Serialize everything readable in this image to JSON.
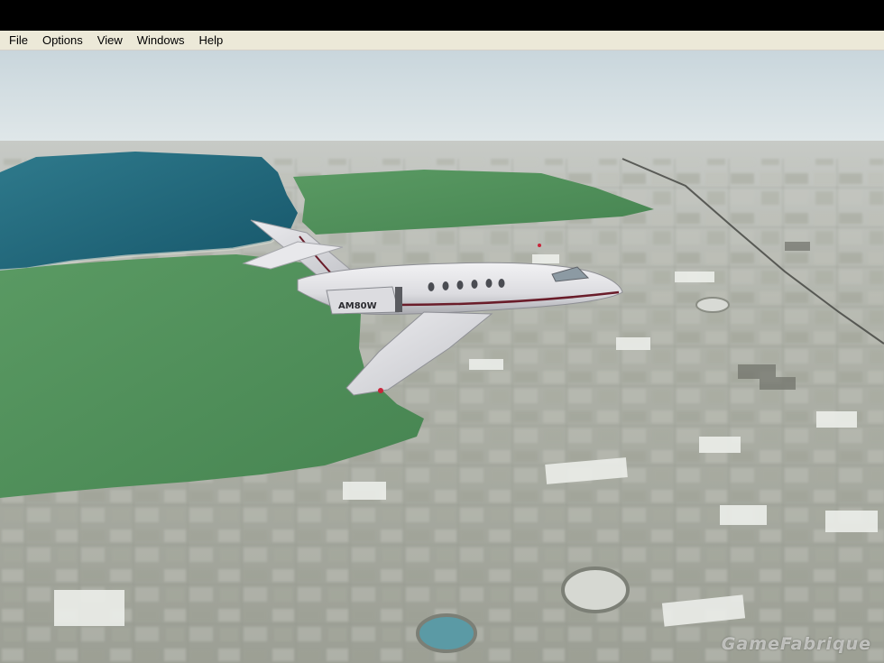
{
  "menu": {
    "items": [
      {
        "label": "File"
      },
      {
        "label": "Options"
      },
      {
        "label": "View"
      },
      {
        "label": "Windows"
      },
      {
        "label": "Help"
      }
    ]
  },
  "scene": {
    "sky_color": "#dde6ea",
    "water_color": "#1d5f73",
    "park_color": "#4f8f5a",
    "city_color": "#a9aba2",
    "aircraft": {
      "type": "business-jet",
      "tail_number": "AM80W",
      "body_color": "#e3e3e6",
      "stripe_color": "#6a1d2a"
    }
  },
  "watermark": {
    "text": "GameFabrique"
  }
}
